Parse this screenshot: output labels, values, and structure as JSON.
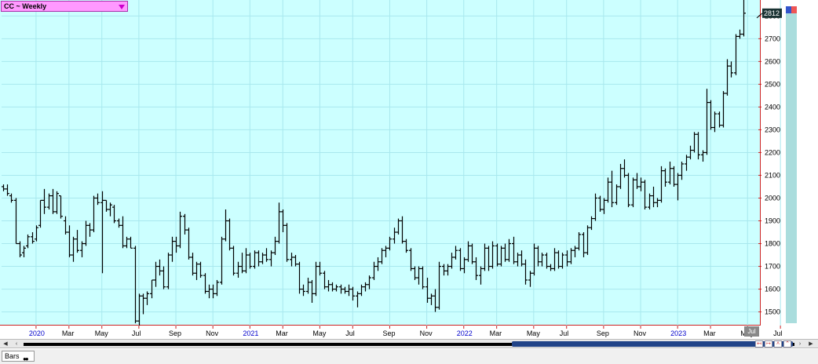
{
  "window": {
    "title": "CC ~ Weekly",
    "last_price_label": "2812",
    "last_marker": "Jul",
    "bottom_tab": "Bars"
  },
  "colors": {
    "plot_bg": "#ccffff",
    "bars": "#000000",
    "title_bg": "#ff99ff",
    "price_label_bg": "#1a3333",
    "axis_line": "#cc2222",
    "year_label": "#0000cc",
    "scroll_thumb": "#224488"
  },
  "icons": {
    "title_dropdown": "chevron-down-icon",
    "scroll_left": "arrow-left-icon",
    "scroll_right": "arrow-right-icon"
  },
  "chart_data": {
    "type": "ohlc",
    "title": "CC ~ Weekly",
    "ylim": [
      1440,
      2870
    ],
    "y_ticks": [
      1500,
      1600,
      1700,
      1800,
      1900,
      2000,
      2100,
      2200,
      2300,
      2400,
      2500,
      2600,
      2700,
      2800
    ],
    "x_ticks": [
      {
        "label": "2020",
        "year": true,
        "week": 8
      },
      {
        "label": "Mar",
        "year": false,
        "week": 16
      },
      {
        "label": "May",
        "year": false,
        "week": 24
      },
      {
        "label": "Jul",
        "year": false,
        "week": 33
      },
      {
        "label": "Sep",
        "year": false,
        "week": 42
      },
      {
        "label": "Nov",
        "year": false,
        "week": 51
      },
      {
        "label": "2021",
        "year": true,
        "week": 60
      },
      {
        "label": "Mar",
        "year": false,
        "week": 68
      },
      {
        "label": "May",
        "year": false,
        "week": 77
      },
      {
        "label": "Jul",
        "year": false,
        "week": 85
      },
      {
        "label": "Sep",
        "year": false,
        "week": 94
      },
      {
        "label": "Nov",
        "year": false,
        "week": 103
      },
      {
        "label": "2022",
        "year": true,
        "week": 112
      },
      {
        "label": "Mar",
        "year": false,
        "week": 120
      },
      {
        "label": "May",
        "year": false,
        "week": 129
      },
      {
        "label": "Jul",
        "year": false,
        "week": 137
      },
      {
        "label": "Sep",
        "year": false,
        "week": 146
      },
      {
        "label": "Nov",
        "year": false,
        "week": 155
      },
      {
        "label": "2023",
        "year": true,
        "week": 164
      },
      {
        "label": "Mar",
        "year": false,
        "week": 172
      },
      {
        "label": "May",
        "year": false,
        "week": 181
      },
      {
        "label": "Jul",
        "year": false,
        "week": 189
      }
    ],
    "ohlc": [
      [
        2050,
        2060,
        2030,
        2040
      ],
      [
        2040,
        2060,
        2010,
        2020
      ],
      [
        2010,
        2020,
        1980,
        1990
      ],
      [
        1990,
        2000,
        1800,
        1800
      ],
      [
        1800,
        1810,
        1740,
        1750
      ],
      [
        1760,
        1790,
        1740,
        1780
      ],
      [
        1790,
        1840,
        1780,
        1830
      ],
      [
        1830,
        1850,
        1800,
        1810
      ],
      [
        1820,
        1880,
        1810,
        1870
      ],
      [
        1880,
        1990,
        1870,
        1990
      ],
      [
        1990,
        2040,
        1930,
        1960
      ],
      [
        1960,
        2020,
        1950,
        2010
      ],
      [
        2010,
        2040,
        1930,
        1940
      ],
      [
        1940,
        2030,
        1930,
        2020
      ],
      [
        2010,
        2010,
        1910,
        1920
      ],
      [
        1900,
        1920,
        1840,
        1850
      ],
      [
        1850,
        1880,
        1740,
        1750
      ],
      [
        1750,
        1830,
        1720,
        1820
      ],
      [
        1820,
        1860,
        1760,
        1770
      ],
      [
        1770,
        1810,
        1740,
        1800
      ],
      [
        1800,
        1900,
        1790,
        1880
      ],
      [
        1880,
        1890,
        1830,
        1860
      ],
      [
        1860,
        2010,
        1850,
        2000
      ],
      [
        2000,
        2020,
        1970,
        1980
      ],
      [
        1980,
        2030,
        1670,
        1990
      ],
      [
        1990,
        1990,
        1940,
        1950
      ],
      [
        1950,
        1980,
        1920,
        1970
      ],
      [
        1960,
        1970,
        1890,
        1900
      ],
      [
        1900,
        1910,
        1870,
        1880
      ],
      [
        1880,
        1920,
        1780,
        1790
      ],
      [
        1790,
        1830,
        1780,
        1820
      ],
      [
        1820,
        1830,
        1780,
        1780
      ],
      [
        1780,
        1790,
        1450,
        1460
      ],
      [
        1460,
        1580,
        1440,
        1570
      ],
      [
        1570,
        1580,
        1490,
        1560
      ],
      [
        1560,
        1590,
        1530,
        1580
      ],
      [
        1580,
        1640,
        1560,
        1640
      ],
      [
        1640,
        1720,
        1610,
        1700
      ],
      [
        1700,
        1730,
        1660,
        1680
      ],
      [
        1680,
        1700,
        1600,
        1610
      ],
      [
        1610,
        1760,
        1600,
        1750
      ],
      [
        1750,
        1830,
        1720,
        1810
      ],
      [
        1810,
        1830,
        1760,
        1790
      ],
      [
        1790,
        1940,
        1780,
        1920
      ],
      [
        1920,
        1930,
        1840,
        1860
      ],
      [
        1860,
        1870,
        1730,
        1740
      ],
      [
        1740,
        1760,
        1660,
        1670
      ],
      [
        1670,
        1720,
        1640,
        1710
      ],
      [
        1710,
        1720,
        1650,
        1660
      ],
      [
        1660,
        1670,
        1580,
        1590
      ],
      [
        1590,
        1620,
        1560,
        1600
      ],
      [
        1600,
        1620,
        1560,
        1580
      ],
      [
        1580,
        1640,
        1570,
        1630
      ],
      [
        1630,
        1830,
        1620,
        1820
      ],
      [
        1820,
        1950,
        1810,
        1900
      ],
      [
        1900,
        1910,
        1770,
        1780
      ],
      [
        1780,
        1790,
        1660,
        1670
      ],
      [
        1670,
        1720,
        1650,
        1700
      ],
      [
        1700,
        1760,
        1670,
        1680
      ],
      [
        1680,
        1780,
        1670,
        1750
      ],
      [
        1750,
        1760,
        1690,
        1700
      ],
      [
        1700,
        1770,
        1690,
        1760
      ],
      [
        1760,
        1770,
        1700,
        1720
      ],
      [
        1720,
        1760,
        1710,
        1750
      ],
      [
        1750,
        1780,
        1720,
        1730
      ],
      [
        1730,
        1770,
        1700,
        1760
      ],
      [
        1760,
        1830,
        1750,
        1810
      ],
      [
        1810,
        1980,
        1800,
        1940
      ],
      [
        1940,
        1950,
        1850,
        1880
      ],
      [
        1880,
        1890,
        1720,
        1730
      ],
      [
        1730,
        1760,
        1700,
        1740
      ],
      [
        1740,
        1750,
        1700,
        1710
      ],
      [
        1710,
        1720,
        1580,
        1600
      ],
      [
        1600,
        1620,
        1570,
        1590
      ],
      [
        1590,
        1650,
        1580,
        1630
      ],
      [
        1630,
        1640,
        1540,
        1580
      ],
      [
        1580,
        1720,
        1570,
        1700
      ],
      [
        1700,
        1720,
        1660,
        1670
      ],
      [
        1670,
        1680,
        1600,
        1610
      ],
      [
        1610,
        1640,
        1590,
        1620
      ],
      [
        1620,
        1630,
        1590,
        1600
      ],
      [
        1600,
        1620,
        1590,
        1610
      ],
      [
        1610,
        1620,
        1580,
        1600
      ],
      [
        1600,
        1610,
        1580,
        1590
      ],
      [
        1590,
        1620,
        1570,
        1600
      ],
      [
        1600,
        1610,
        1550,
        1570
      ],
      [
        1570,
        1590,
        1520,
        1580
      ],
      [
        1580,
        1620,
        1570,
        1610
      ],
      [
        1610,
        1630,
        1590,
        1620
      ],
      [
        1620,
        1660,
        1600,
        1650
      ],
      [
        1650,
        1720,
        1640,
        1700
      ],
      [
        1700,
        1740,
        1680,
        1720
      ],
      [
        1720,
        1780,
        1710,
        1770
      ],
      [
        1770,
        1790,
        1740,
        1780
      ],
      [
        1780,
        1830,
        1770,
        1820
      ],
      [
        1820,
        1870,
        1800,
        1850
      ],
      [
        1850,
        1910,
        1840,
        1900
      ],
      [
        1900,
        1920,
        1800,
        1810
      ],
      [
        1810,
        1820,
        1760,
        1770
      ],
      [
        1770,
        1780,
        1680,
        1690
      ],
      [
        1690,
        1700,
        1640,
        1650
      ],
      [
        1650,
        1700,
        1620,
        1690
      ],
      [
        1690,
        1700,
        1600,
        1610
      ],
      [
        1610,
        1650,
        1540,
        1560
      ],
      [
        1560,
        1580,
        1530,
        1570
      ],
      [
        1570,
        1600,
        1500,
        1520
      ],
      [
        1520,
        1720,
        1510,
        1700
      ],
      [
        1700,
        1710,
        1660,
        1680
      ],
      [
        1680,
        1710,
        1660,
        1700
      ],
      [
        1700,
        1760,
        1690,
        1740
      ],
      [
        1740,
        1790,
        1730,
        1770
      ],
      [
        1770,
        1780,
        1680,
        1690
      ],
      [
        1690,
        1740,
        1670,
        1730
      ],
      [
        1730,
        1810,
        1720,
        1790
      ],
      [
        1790,
        1800,
        1710,
        1720
      ],
      [
        1720,
        1740,
        1640,
        1660
      ],
      [
        1660,
        1700,
        1620,
        1690
      ],
      [
        1690,
        1800,
        1680,
        1780
      ],
      [
        1780,
        1790,
        1680,
        1700
      ],
      [
        1700,
        1810,
        1690,
        1790
      ],
      [
        1790,
        1800,
        1700,
        1710
      ],
      [
        1710,
        1790,
        1700,
        1780
      ],
      [
        1780,
        1800,
        1720,
        1730
      ],
      [
        1730,
        1820,
        1720,
        1800
      ],
      [
        1800,
        1830,
        1710,
        1720
      ],
      [
        1720,
        1760,
        1700,
        1750
      ],
      [
        1750,
        1770,
        1700,
        1710
      ],
      [
        1710,
        1730,
        1620,
        1640
      ],
      [
        1640,
        1680,
        1610,
        1670
      ],
      [
        1670,
        1800,
        1660,
        1780
      ],
      [
        1780,
        1790,
        1700,
        1720
      ],
      [
        1720,
        1760,
        1700,
        1750
      ],
      [
        1750,
        1760,
        1690,
        1700
      ],
      [
        1700,
        1710,
        1680,
        1690
      ],
      [
        1690,
        1780,
        1680,
        1760
      ],
      [
        1760,
        1770,
        1690,
        1700
      ],
      [
        1700,
        1760,
        1690,
        1750
      ],
      [
        1750,
        1770,
        1700,
        1720
      ],
      [
        1720,
        1780,
        1710,
        1770
      ],
      [
        1770,
        1790,
        1740,
        1780
      ],
      [
        1780,
        1850,
        1770,
        1840
      ],
      [
        1840,
        1850,
        1740,
        1760
      ],
      [
        1760,
        1880,
        1750,
        1870
      ],
      [
        1870,
        1920,
        1860,
        1910
      ],
      [
        1910,
        2020,
        1900,
        2000
      ],
      [
        2000,
        2010,
        1940,
        1950
      ],
      [
        1950,
        2000,
        1930,
        1990
      ],
      [
        1990,
        2090,
        1980,
        2070
      ],
      [
        2070,
        2120,
        1960,
        1980
      ],
      [
        1980,
        2060,
        1970,
        2050
      ],
      [
        2050,
        2150,
        2040,
        2130
      ],
      [
        2130,
        2170,
        2090,
        2100
      ],
      [
        2100,
        2110,
        1960,
        1970
      ],
      [
        1970,
        2090,
        1960,
        2080
      ],
      [
        2080,
        2110,
        2040,
        2050
      ],
      [
        2050,
        2090,
        2030,
        2070
      ],
      [
        2070,
        2080,
        1950,
        1960
      ],
      [
        1960,
        2020,
        1950,
        2010
      ],
      [
        2010,
        2050,
        1960,
        1980
      ],
      [
        1980,
        2000,
        1960,
        1990
      ],
      [
        1990,
        2140,
        1980,
        2120
      ],
      [
        2120,
        2130,
        2050,
        2070
      ],
      [
        2070,
        2160,
        2060,
        2130
      ],
      [
        2130,
        2140,
        2050,
        2060
      ],
      [
        2060,
        2110,
        1990,
        2100
      ],
      [
        2100,
        2160,
        2080,
        2150
      ],
      [
        2150,
        2190,
        2120,
        2180
      ],
      [
        2180,
        2230,
        2170,
        2210
      ],
      [
        2210,
        2290,
        2200,
        2280
      ],
      [
        2280,
        2290,
        2170,
        2190
      ],
      [
        2190,
        2210,
        2160,
        2200
      ],
      [
        2200,
        2480,
        2190,
        2420
      ],
      [
        2420,
        2430,
        2300,
        2310
      ],
      [
        2310,
        2380,
        2290,
        2370
      ],
      [
        2370,
        2380,
        2310,
        2320
      ],
      [
        2320,
        2470,
        2310,
        2460
      ],
      [
        2460,
        2610,
        2450,
        2580
      ],
      [
        2580,
        2600,
        2530,
        2550
      ],
      [
        2550,
        2720,
        2540,
        2710
      ],
      [
        2710,
        2740,
        2700,
        2720
      ],
      [
        2720,
        2880,
        2710,
        2812
      ]
    ]
  }
}
